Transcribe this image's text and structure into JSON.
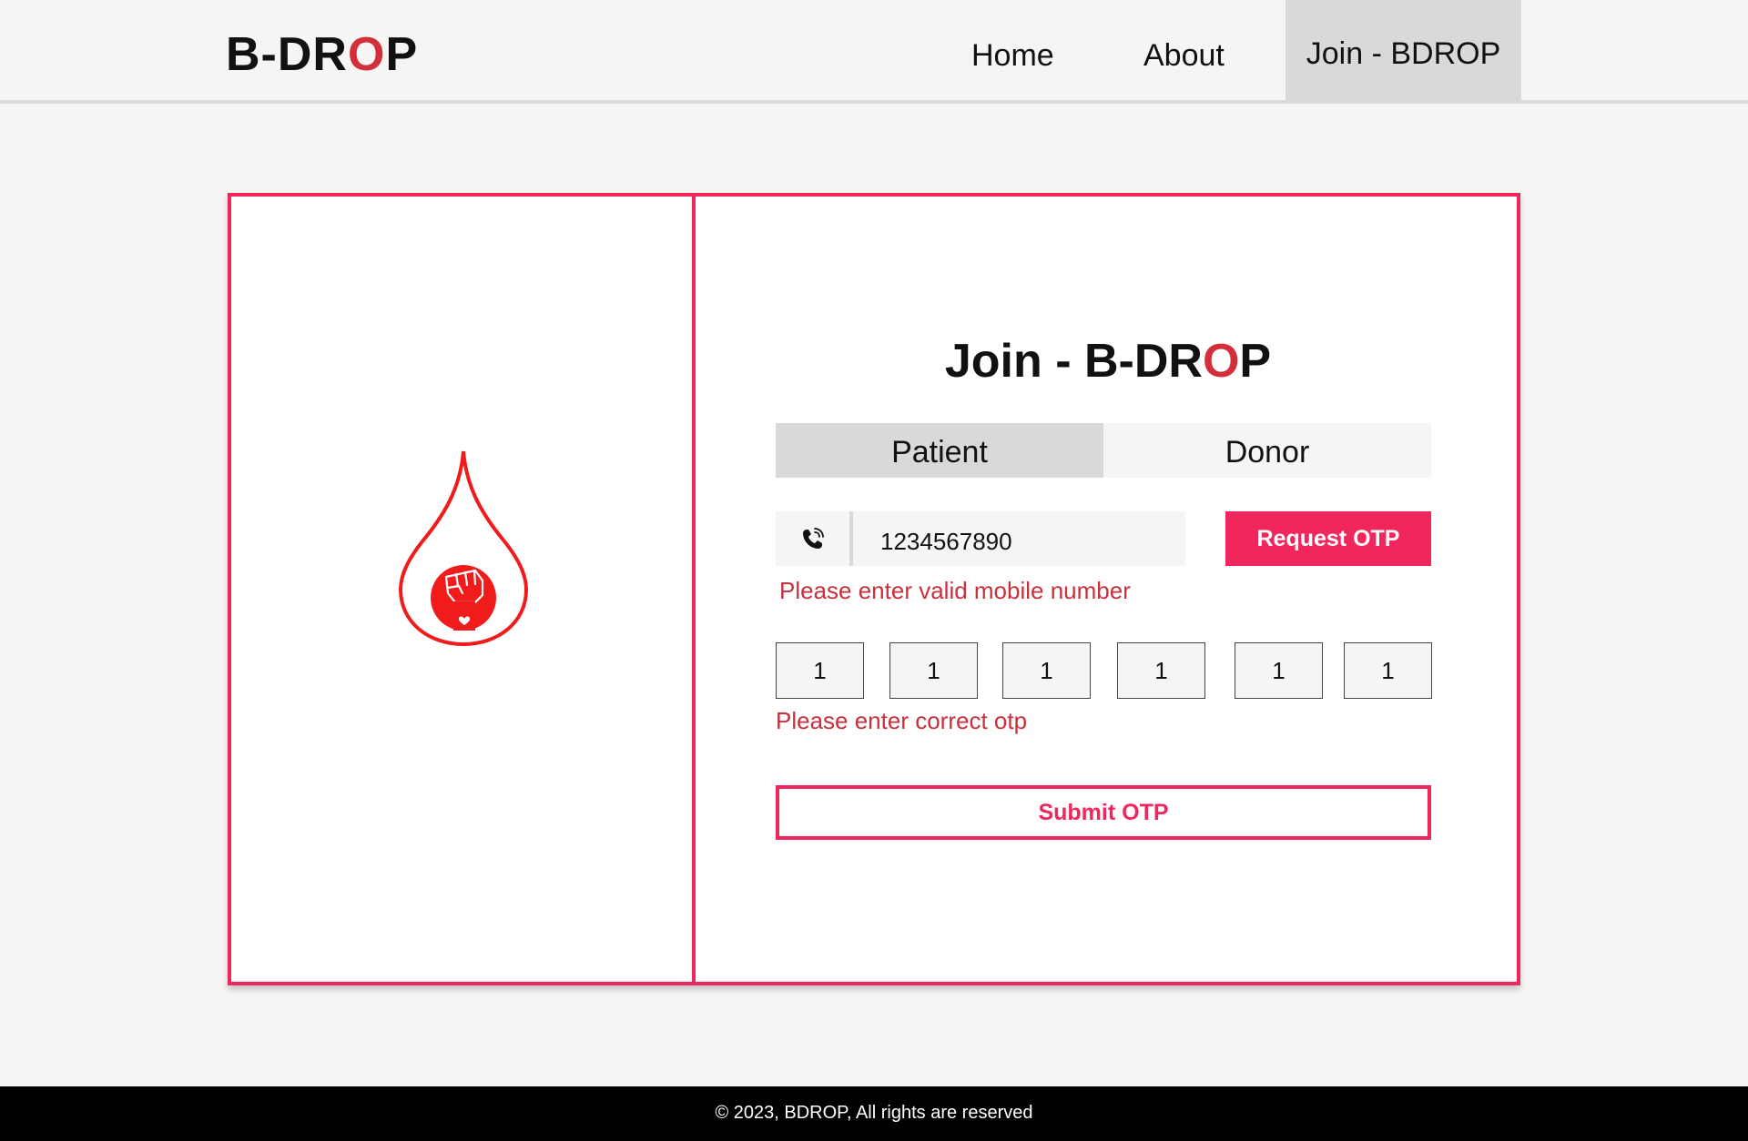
{
  "header": {
    "logo": {
      "part1": "B-DR",
      "accent": "O",
      "part2": "P"
    },
    "nav": [
      {
        "label": "Home"
      },
      {
        "label": "About"
      },
      {
        "label": "Join - BDROP"
      }
    ],
    "active_nav": "Join - BDROP"
  },
  "card": {
    "title": {
      "part1": "Join - B-DR",
      "accent": "O",
      "part2": "P"
    },
    "tabs": [
      {
        "label": "Patient"
      },
      {
        "label": "Donor"
      }
    ],
    "active_tab": "Patient",
    "phone": {
      "icon": "phone-icon",
      "value": "1234567890"
    },
    "request_otp_label": "Request OTP",
    "phone_error": "Please enter valid mobile number",
    "otp_values": [
      "1",
      "1",
      "1",
      "1",
      "1",
      "1"
    ],
    "otp_error": "Please enter correct otp",
    "submit_label": "Submit OTP",
    "illustration_icon": "blood-drop-fist-icon"
  },
  "footer": {
    "text": "© 2023, BDROP, All rights are reserved"
  },
  "colors": {
    "accent_pink": "#f0265c",
    "logo_accent_red": "#d32f3b",
    "error_red": "#c9303c",
    "drop_red": "#f01c1c",
    "page_bg": "#f7f5f4",
    "tab_active_bg": "#d9d9d9",
    "footer_bg": "#000000"
  }
}
